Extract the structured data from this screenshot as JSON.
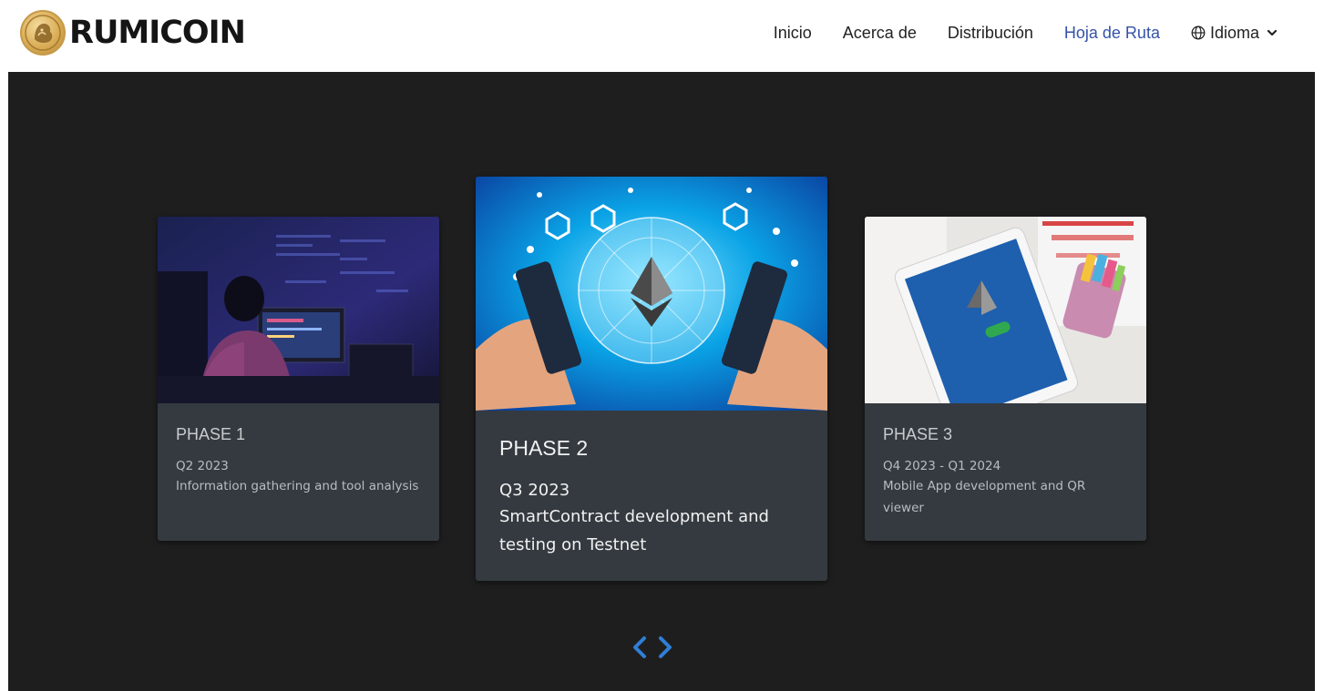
{
  "brand": {
    "name": "RUMICOIN",
    "logo_icon": "rumicoin-coin-icon"
  },
  "nav": {
    "items": [
      {
        "label": "Inicio",
        "active": false
      },
      {
        "label": "Acerca de",
        "active": false
      },
      {
        "label": "Distribución",
        "active": false
      },
      {
        "label": "Hoja de Ruta",
        "active": true
      }
    ],
    "language_label": "Idioma",
    "language_icon": "globe-icon",
    "active_color": "#3552a8"
  },
  "roadmap": {
    "cards": [
      {
        "phase": "PHASE 1",
        "period": "Q2 2023",
        "description": "Information gathering and tool analysis",
        "image": "person-at-computer-image"
      },
      {
        "phase": "PHASE 2",
        "period": "Q3 2023",
        "description": "SmartContract development and testing on Testnet",
        "image": "blockchain-ethereum-image"
      },
      {
        "phase": "PHASE 3",
        "period": "Q4 2023 - Q1 2024",
        "description": "Mobile App development and QR viewer",
        "image": "tablet-vpn-image"
      }
    ],
    "prev_icon": "chevron-left-icon",
    "next_icon": "chevron-right-icon",
    "accent_color": "#2f7fd6",
    "card_color": "#343a40",
    "background_color": "#1e1e1f"
  }
}
